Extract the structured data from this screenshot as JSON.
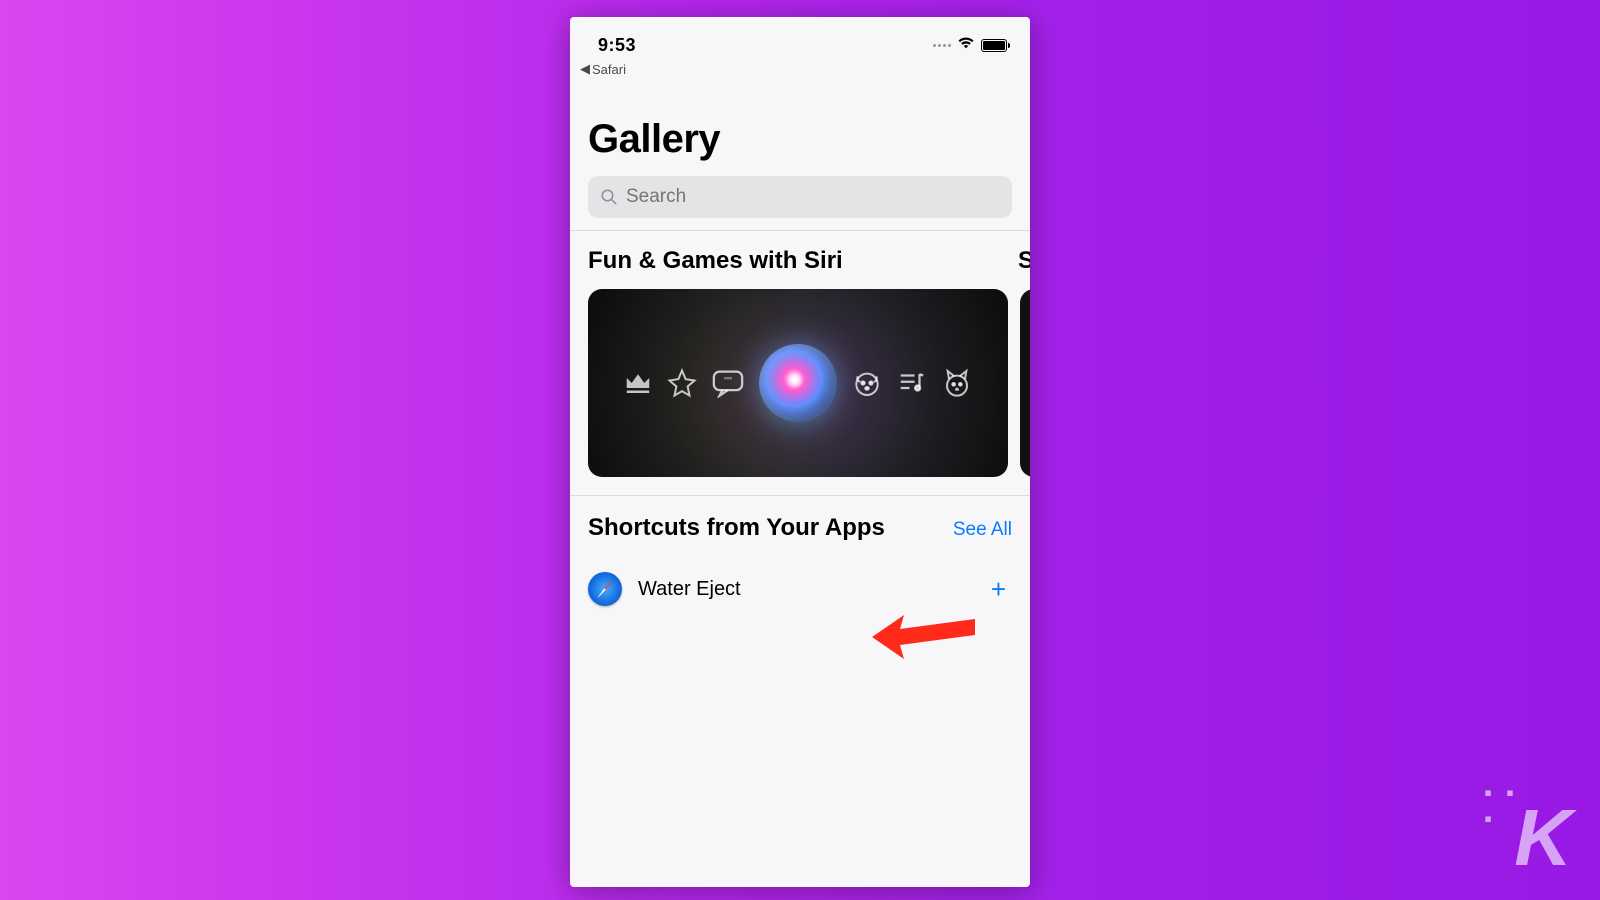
{
  "status": {
    "time": "9:53",
    "back_app": "Safari"
  },
  "header": {
    "title": "Gallery",
    "search_placeholder": "Search"
  },
  "carousel": {
    "title": "Fun & Games with Siri",
    "peek_letter": "S"
  },
  "apps": {
    "title": "Shortcuts from Your Apps",
    "see_all": "See All",
    "items": [
      {
        "label": "Water Eject"
      }
    ]
  },
  "watermark": "K"
}
